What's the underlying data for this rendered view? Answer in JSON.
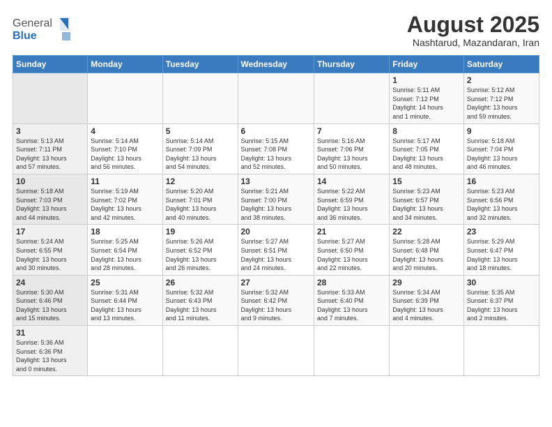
{
  "header": {
    "logo_general": "General",
    "logo_blue": "Blue",
    "title": "August 2025",
    "subtitle": "Nashtarud, Mazandaran, Iran"
  },
  "weekdays": [
    "Sunday",
    "Monday",
    "Tuesday",
    "Wednesday",
    "Thursday",
    "Friday",
    "Saturday"
  ],
  "weeks": [
    [
      {
        "day": "",
        "info": ""
      },
      {
        "day": "",
        "info": ""
      },
      {
        "day": "",
        "info": ""
      },
      {
        "day": "",
        "info": ""
      },
      {
        "day": "",
        "info": ""
      },
      {
        "day": "1",
        "info": "Sunrise: 5:11 AM\nSunset: 7:12 PM\nDaylight: 14 hours\nand 1 minute."
      },
      {
        "day": "2",
        "info": "Sunrise: 5:12 AM\nSunset: 7:12 PM\nDaylight: 13 hours\nand 59 minutes."
      }
    ],
    [
      {
        "day": "3",
        "info": "Sunrise: 5:13 AM\nSunset: 7:11 PM\nDaylight: 13 hours\nand 57 minutes."
      },
      {
        "day": "4",
        "info": "Sunrise: 5:14 AM\nSunset: 7:10 PM\nDaylight: 13 hours\nand 56 minutes."
      },
      {
        "day": "5",
        "info": "Sunrise: 5:14 AM\nSunset: 7:09 PM\nDaylight: 13 hours\nand 54 minutes."
      },
      {
        "day": "6",
        "info": "Sunrise: 5:15 AM\nSunset: 7:08 PM\nDaylight: 13 hours\nand 52 minutes."
      },
      {
        "day": "7",
        "info": "Sunrise: 5:16 AM\nSunset: 7:06 PM\nDaylight: 13 hours\nand 50 minutes."
      },
      {
        "day": "8",
        "info": "Sunrise: 5:17 AM\nSunset: 7:05 PM\nDaylight: 13 hours\nand 48 minutes."
      },
      {
        "day": "9",
        "info": "Sunrise: 5:18 AM\nSunset: 7:04 PM\nDaylight: 13 hours\nand 46 minutes."
      }
    ],
    [
      {
        "day": "10",
        "info": "Sunrise: 5:18 AM\nSunset: 7:03 PM\nDaylight: 13 hours\nand 44 minutes."
      },
      {
        "day": "11",
        "info": "Sunrise: 5:19 AM\nSunset: 7:02 PM\nDaylight: 13 hours\nand 42 minutes."
      },
      {
        "day": "12",
        "info": "Sunrise: 5:20 AM\nSunset: 7:01 PM\nDaylight: 13 hours\nand 40 minutes."
      },
      {
        "day": "13",
        "info": "Sunrise: 5:21 AM\nSunset: 7:00 PM\nDaylight: 13 hours\nand 38 minutes."
      },
      {
        "day": "14",
        "info": "Sunrise: 5:22 AM\nSunset: 6:59 PM\nDaylight: 13 hours\nand 36 minutes."
      },
      {
        "day": "15",
        "info": "Sunrise: 5:23 AM\nSunset: 6:57 PM\nDaylight: 13 hours\nand 34 minutes."
      },
      {
        "day": "16",
        "info": "Sunrise: 5:23 AM\nSunset: 6:56 PM\nDaylight: 13 hours\nand 32 minutes."
      }
    ],
    [
      {
        "day": "17",
        "info": "Sunrise: 5:24 AM\nSunset: 6:55 PM\nDaylight: 13 hours\nand 30 minutes."
      },
      {
        "day": "18",
        "info": "Sunrise: 5:25 AM\nSunset: 6:54 PM\nDaylight: 13 hours\nand 28 minutes."
      },
      {
        "day": "19",
        "info": "Sunrise: 5:26 AM\nSunset: 6:52 PM\nDaylight: 13 hours\nand 26 minutes."
      },
      {
        "day": "20",
        "info": "Sunrise: 5:27 AM\nSunset: 6:51 PM\nDaylight: 13 hours\nand 24 minutes."
      },
      {
        "day": "21",
        "info": "Sunrise: 5:27 AM\nSunset: 6:50 PM\nDaylight: 13 hours\nand 22 minutes."
      },
      {
        "day": "22",
        "info": "Sunrise: 5:28 AM\nSunset: 6:48 PM\nDaylight: 13 hours\nand 20 minutes."
      },
      {
        "day": "23",
        "info": "Sunrise: 5:29 AM\nSunset: 6:47 PM\nDaylight: 13 hours\nand 18 minutes."
      }
    ],
    [
      {
        "day": "24",
        "info": "Sunrise: 5:30 AM\nSunset: 6:46 PM\nDaylight: 13 hours\nand 15 minutes."
      },
      {
        "day": "25",
        "info": "Sunrise: 5:31 AM\nSunset: 6:44 PM\nDaylight: 13 hours\nand 13 minutes."
      },
      {
        "day": "26",
        "info": "Sunrise: 5:32 AM\nSunset: 6:43 PM\nDaylight: 13 hours\nand 11 minutes."
      },
      {
        "day": "27",
        "info": "Sunrise: 5:32 AM\nSunset: 6:42 PM\nDaylight: 13 hours\nand 9 minutes."
      },
      {
        "day": "28",
        "info": "Sunrise: 5:33 AM\nSunset: 6:40 PM\nDaylight: 13 hours\nand 7 minutes."
      },
      {
        "day": "29",
        "info": "Sunrise: 5:34 AM\nSunset: 6:39 PM\nDaylight: 13 hours\nand 4 minutes."
      },
      {
        "day": "30",
        "info": "Sunrise: 5:35 AM\nSunset: 6:37 PM\nDaylight: 13 hours\nand 2 minutes."
      }
    ],
    [
      {
        "day": "31",
        "info": "Sunrise: 5:36 AM\nSunset: 6:36 PM\nDaylight: 13 hours\nand 0 minutes."
      },
      {
        "day": "",
        "info": ""
      },
      {
        "day": "",
        "info": ""
      },
      {
        "day": "",
        "info": ""
      },
      {
        "day": "",
        "info": ""
      },
      {
        "day": "",
        "info": ""
      },
      {
        "day": "",
        "info": ""
      }
    ]
  ]
}
